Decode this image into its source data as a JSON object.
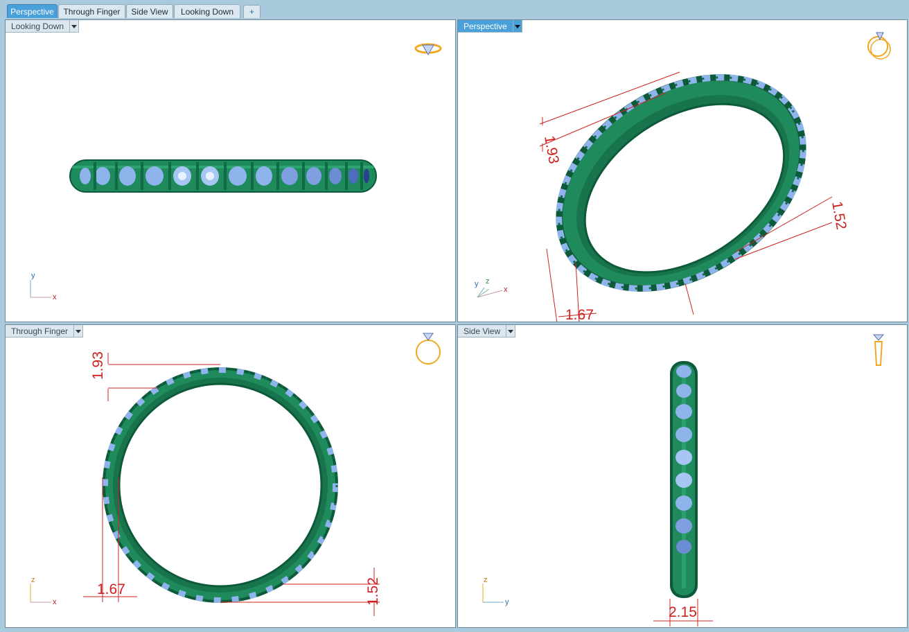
{
  "tabs": [
    {
      "label": "Perspective",
      "active": true
    },
    {
      "label": "Through Finger",
      "active": false
    },
    {
      "label": "Side View",
      "active": false
    },
    {
      "label": "Looking Down",
      "active": false
    }
  ],
  "add_tab_glyph": "+",
  "viewports": {
    "top_left": {
      "title": "Looking Down",
      "axes": [
        "y",
        "x"
      ]
    },
    "top_right": {
      "title": "Perspective",
      "axes": [
        "y",
        "z",
        "x"
      ],
      "dims": [
        "1.93",
        "1.52",
        "1.67"
      ]
    },
    "bottom_left": {
      "title": "Through Finger",
      "axes": [
        "z",
        "x"
      ],
      "dims": [
        "1.93",
        "1.67",
        "1.52"
      ]
    },
    "bottom_right": {
      "title": "Side View",
      "axes": [
        "z",
        "y"
      ],
      "dims": [
        "2.15"
      ]
    }
  },
  "colors": {
    "ring_green": "#1f8a5c",
    "ring_dark": "#0d5a3a",
    "stone_blue": "#8fb4ec",
    "dimension_red": "#d02020",
    "active_tab": "#4aa0d8",
    "icon_gold": "#f0a820"
  },
  "icons": {
    "top_left": "ring-top-view-icon",
    "top_right": "ring-perspective-icon",
    "bottom_left": "ring-front-view-icon",
    "bottom_right": "ring-side-view-icon"
  }
}
